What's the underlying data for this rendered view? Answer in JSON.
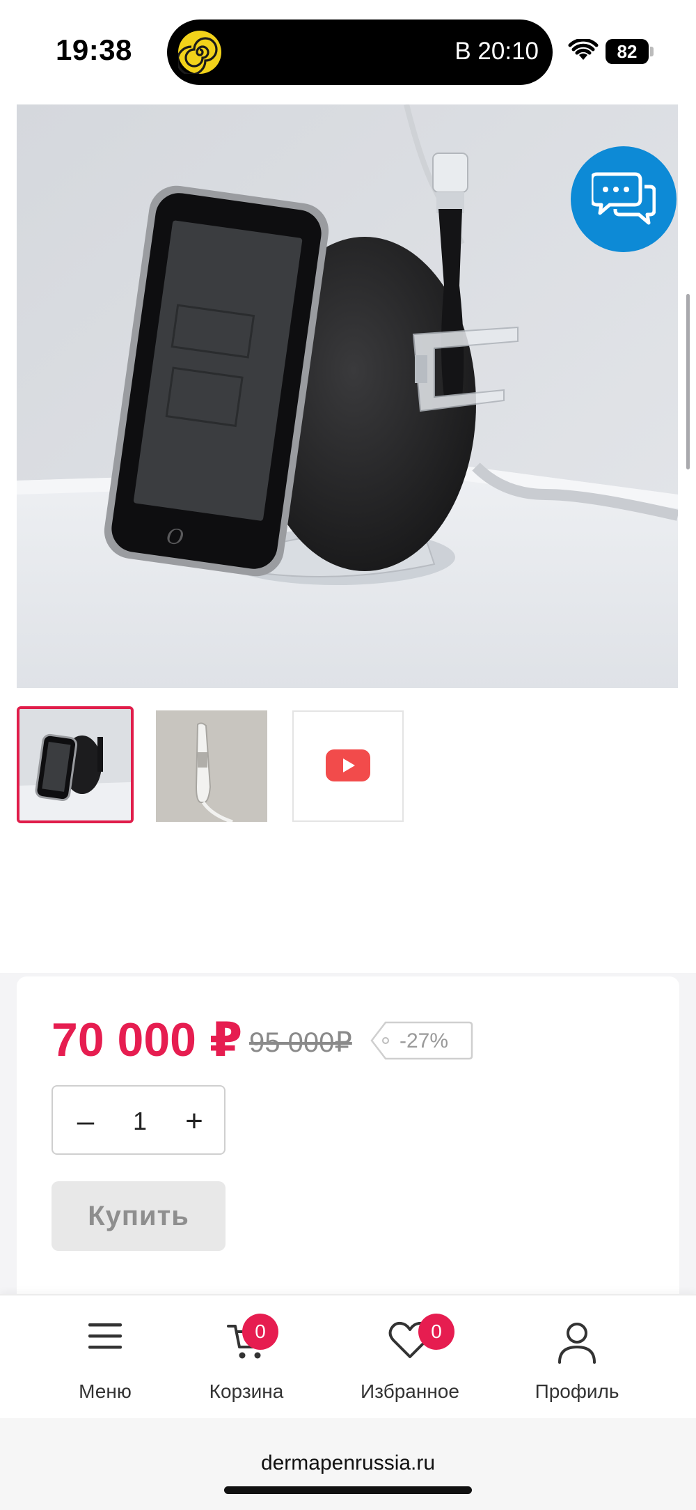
{
  "status_bar": {
    "time": "19:38",
    "island_text": "В 20:10",
    "battery": "82",
    "icons": [
      "wifi-icon",
      "battery-icon",
      "app-spiral-icon"
    ]
  },
  "gallery": {
    "chat_icon": "chat-bubbles-icon",
    "thumbnails": [
      {
        "kind": "image",
        "selected": true
      },
      {
        "kind": "image",
        "selected": false
      },
      {
        "kind": "video",
        "icon": "youtube-play-icon",
        "selected": false
      }
    ]
  },
  "product": {
    "price": "70 000 ₽",
    "old_price": "95 000₽",
    "discount": "-27%",
    "quantity": "1",
    "minus_label": "–",
    "plus_label": "+",
    "buy_label": "Купить"
  },
  "bottom_nav": {
    "items": [
      {
        "label": "Меню",
        "icon": "hamburger-menu-icon"
      },
      {
        "label": "Корзина",
        "icon": "cart-icon",
        "badge": "0"
      },
      {
        "label": "Избранное",
        "icon": "heart-icon",
        "badge": "0"
      },
      {
        "label": "Профиль",
        "icon": "user-icon"
      }
    ]
  },
  "browser": {
    "url": "dermapenrussia.ru"
  },
  "colors": {
    "accent": "#e61d50",
    "chat": "#0d8ad6",
    "youtube": "#f24b4b"
  }
}
